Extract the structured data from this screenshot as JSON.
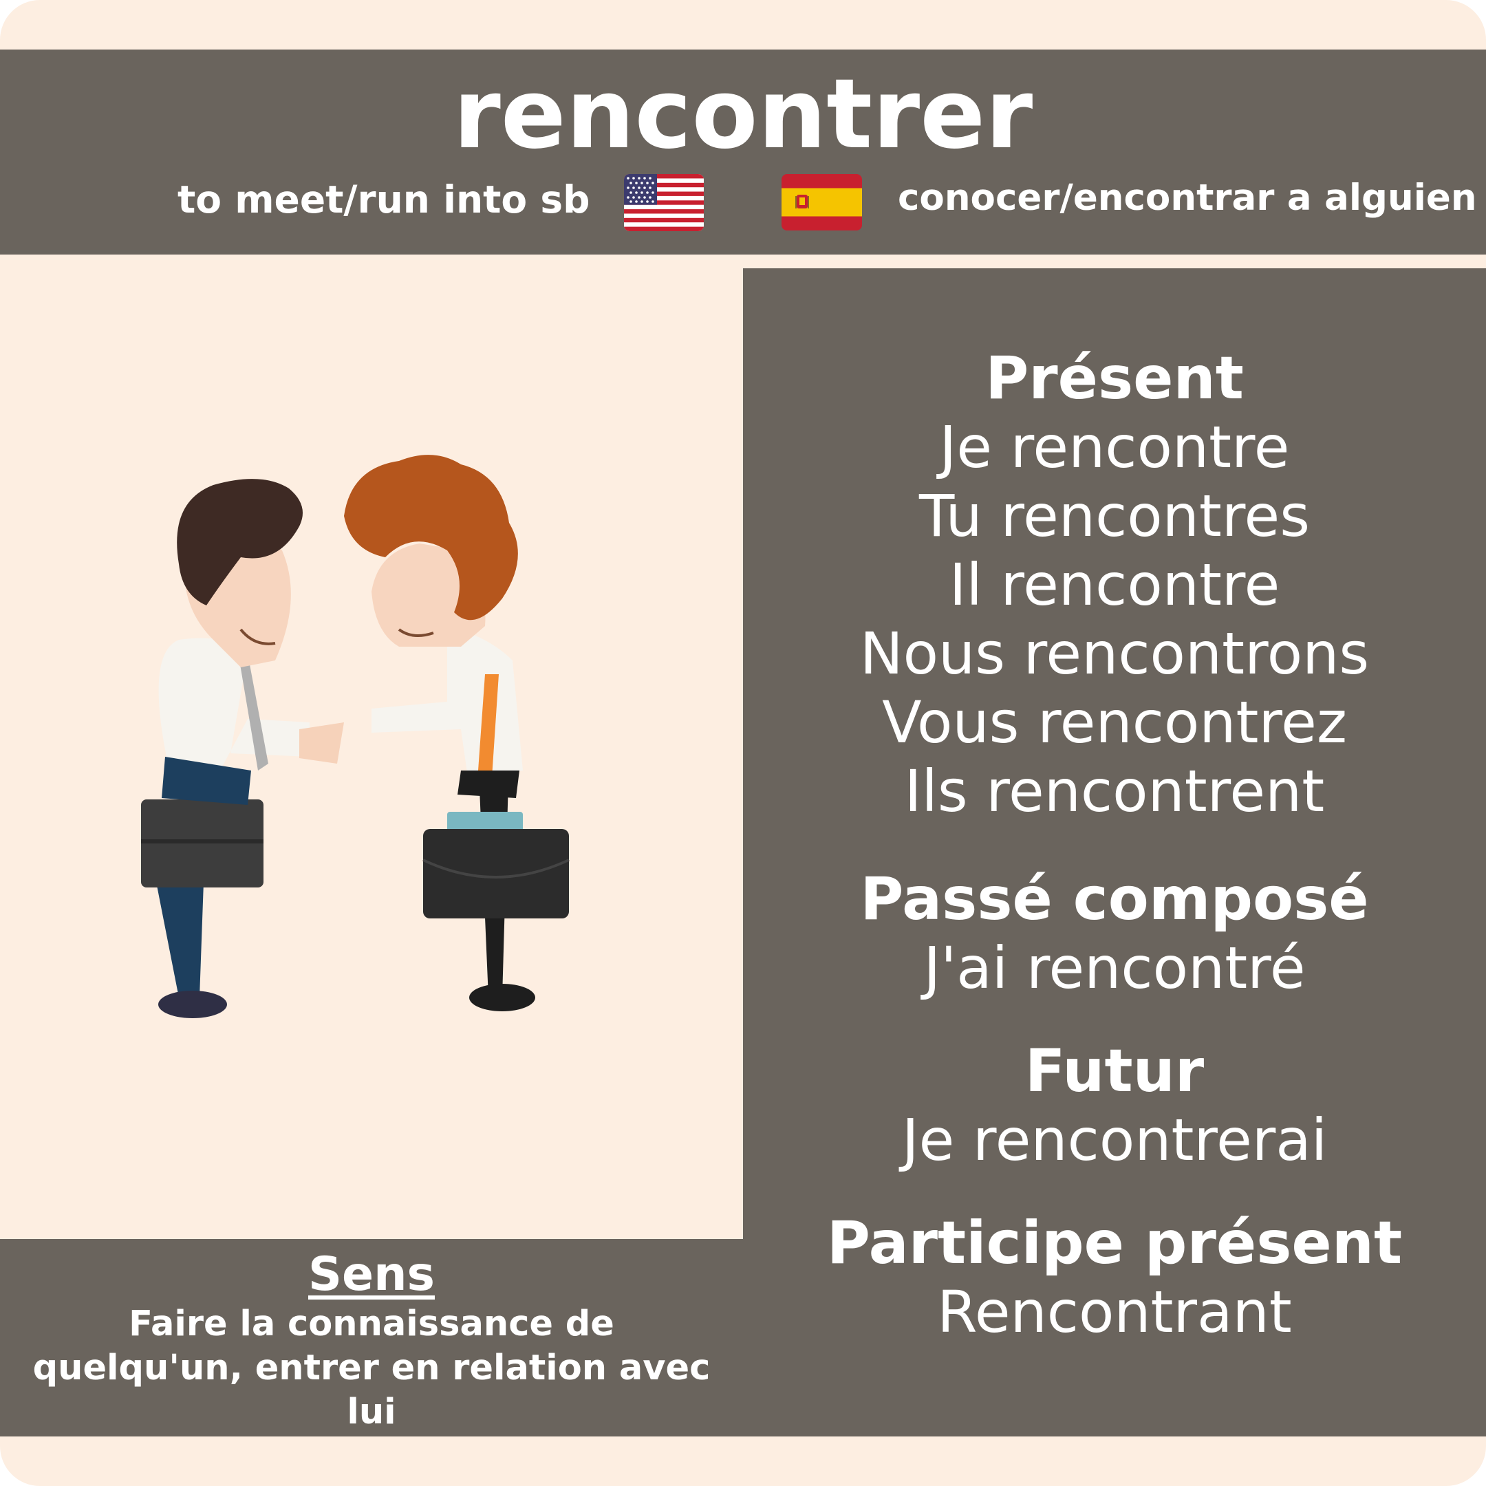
{
  "verb": "rencontrer",
  "translations": {
    "english": "to meet/run into sb",
    "english_flag_icon": "us-flag-icon",
    "spanish": "conocer/encontrar a alguien",
    "spanish_flag_icon": "spain-flag-icon"
  },
  "illustration": "two-businessmen-handshake",
  "conjugation": {
    "present": {
      "label": "Présent",
      "forms": [
        "Je rencontre",
        "Tu rencontres",
        "Il rencontre",
        "Nous rencontrons",
        "Vous rencontrez",
        "Ils rencontrent"
      ]
    },
    "passe_compose": {
      "label": "Passé composé",
      "form": "J'ai rencontré"
    },
    "futur": {
      "label": "Futur",
      "form": "Je rencontrerai"
    },
    "participe_present": {
      "label": "Participe présent",
      "form": "Rencontrant"
    }
  },
  "sens": {
    "title": "Sens",
    "lines": [
      "Faire la connaissance de",
      "quelqu'un, entrer en relation avec",
      "lui"
    ]
  },
  "colors": {
    "background": "#fdeee1",
    "panel": "#6a645d",
    "text": "#ffffff"
  }
}
